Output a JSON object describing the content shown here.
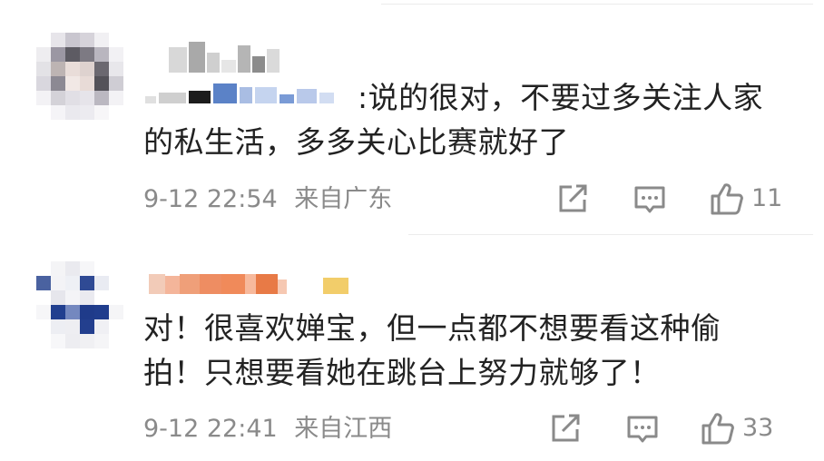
{
  "comments": [
    {
      "text_line1": ":说的很对，不要过多关注人家",
      "text_line2": "的私生活，多多关心比赛就好了",
      "time": "9-12 22:54",
      "location": "来自广东",
      "likes": "11",
      "icons": {
        "share": "share-icon",
        "reply": "comment-icon",
        "like": "thumbs-up-icon"
      }
    },
    {
      "text_line1": "对！很喜欢婵宝，但一点都不想要看这种偷",
      "text_line2": "拍！只想要看她在跳台上努力就够了！",
      "time": "9-12 22:41",
      "location": "来自江西",
      "likes": "33",
      "icons": {
        "share": "share-icon",
        "reply": "comment-icon",
        "like": "thumbs-up-icon"
      }
    }
  ],
  "colors": {
    "text": "#222222",
    "meta": "#8a8a8a",
    "icon": "#8a8a8a"
  }
}
